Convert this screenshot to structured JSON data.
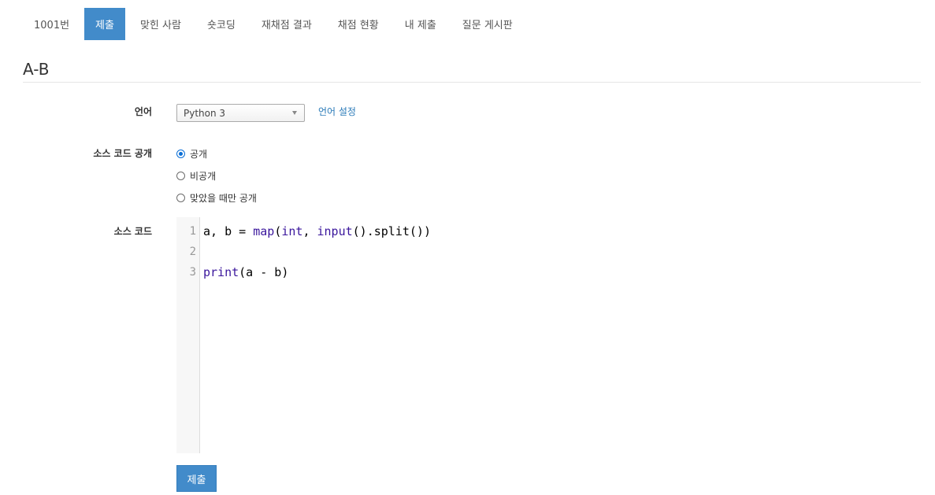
{
  "nav": {
    "tabs": [
      {
        "label": "1001번",
        "active": false
      },
      {
        "label": "제출",
        "active": true
      },
      {
        "label": "맞힌 사람",
        "active": false
      },
      {
        "label": "숏코딩",
        "active": false
      },
      {
        "label": "재채점 결과",
        "active": false
      },
      {
        "label": "채점 현황",
        "active": false
      },
      {
        "label": "내 제출",
        "active": false
      },
      {
        "label": "질문 게시판",
        "active": false
      }
    ],
    "active_color": "#428bca"
  },
  "problem": {
    "title": "A-B"
  },
  "form": {
    "language": {
      "label": "언어",
      "selected": "Python 3",
      "settings_link": "언어 설정"
    },
    "visibility": {
      "label": "소스 코드 공개",
      "options": [
        {
          "label": "공개",
          "checked": true
        },
        {
          "label": "비공개",
          "checked": false
        },
        {
          "label": "맞았을 때만 공개",
          "checked": false
        }
      ]
    },
    "source": {
      "label": "소스 코드",
      "line_numbers": [
        "1",
        "2",
        "3"
      ],
      "lines": [
        {
          "tokens": [
            {
              "text": "a, b = ",
              "kind": "plain"
            },
            {
              "text": "map",
              "kind": "builtin"
            },
            {
              "text": "(",
              "kind": "plain"
            },
            {
              "text": "int",
              "kind": "builtin"
            },
            {
              "text": ", ",
              "kind": "plain"
            },
            {
              "text": "input",
              "kind": "builtin"
            },
            {
              "text": "().split())",
              "kind": "plain"
            }
          ]
        },
        {
          "tokens": []
        },
        {
          "tokens": [
            {
              "text": "print",
              "kind": "builtin"
            },
            {
              "text": "(a - b)",
              "kind": "plain"
            }
          ]
        }
      ]
    },
    "submit_label": "제출"
  },
  "colors": {
    "primary": "#428bca",
    "link": "#2a7ab8",
    "builtin": "#3a169c"
  }
}
